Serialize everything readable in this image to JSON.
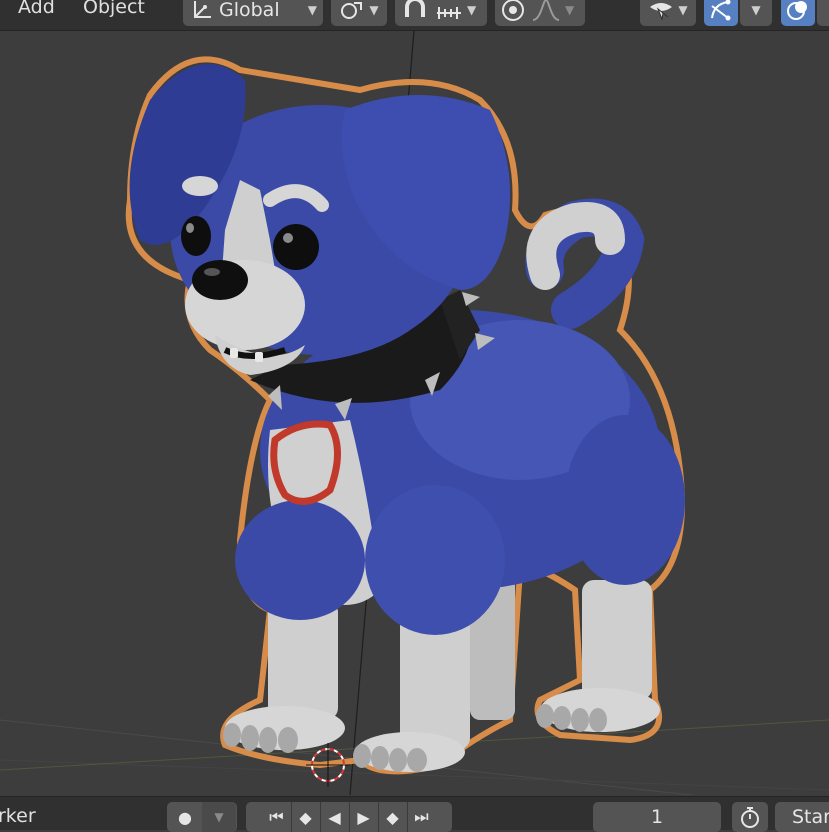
{
  "header": {
    "menu_add": "Add",
    "menu_object": "Object",
    "orientation_label": "Global"
  },
  "icons": {
    "transform": "transform-orientation-icon",
    "pivot": "pivot-point-icon",
    "snap": "snap-magnet-icon",
    "snap_increment": "snap-increment-icon",
    "proportional": "proportional-editing-icon",
    "falloff": "falloff-curve-icon",
    "visibility": "visibility-eye-icon",
    "gizmo": "gizmo-icon",
    "overlay": "overlay-icon"
  },
  "colors": {
    "accent": "#5680c2",
    "header_bg": "#303030",
    "button_bg": "#545454",
    "viewport_bg": "#3d3d3d",
    "selection_outline": "#e8954a",
    "dog_blue": "#3a4aa6"
  },
  "footer": {
    "marker_label": "rker",
    "current_frame": "1",
    "start_label": "Star"
  }
}
